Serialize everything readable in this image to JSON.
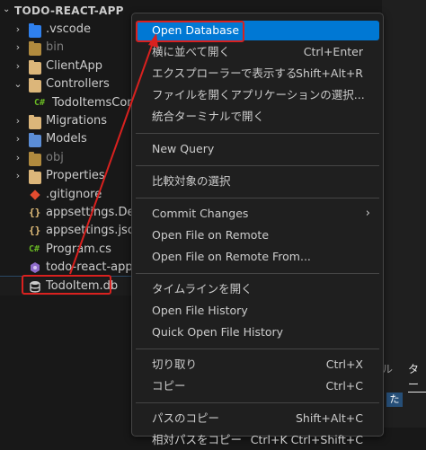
{
  "explorer": {
    "title": "TODO-REACT-APP",
    "items": [
      {
        "label": ".vscode",
        "type": "folder",
        "color": "#2f80ed",
        "chev": "›",
        "dim": false
      },
      {
        "label": "bin",
        "type": "folder",
        "color": "#b08a3e",
        "chev": "›",
        "dim": true
      },
      {
        "label": "ClientApp",
        "type": "folder",
        "color": "#dcb67a",
        "chev": "›",
        "dim": false
      },
      {
        "label": "Controllers",
        "type": "folder",
        "color": "#dcb67a",
        "chev": "⌄",
        "dim": false
      },
      {
        "label": "TodoItemsContro",
        "type": "csharp",
        "chev": "",
        "dim": false
      },
      {
        "label": "Migrations",
        "type": "folder",
        "color": "#dcb67a",
        "chev": "›",
        "dim": false
      },
      {
        "label": "Models",
        "type": "folder",
        "color": "#5b8dd6",
        "chev": "›",
        "dim": false
      },
      {
        "label": "obj",
        "type": "folder",
        "color": "#b08a3e",
        "chev": "›",
        "dim": true
      },
      {
        "label": "Properties",
        "type": "folder",
        "color": "#dcb67a",
        "chev": "›",
        "dim": false
      },
      {
        "label": ".gitignore",
        "type": "git",
        "chev": "",
        "dim": false
      },
      {
        "label": "appsettings.Develo",
        "type": "json",
        "chev": "",
        "dim": false
      },
      {
        "label": "appsettings.json",
        "type": "json",
        "chev": "",
        "dim": false
      },
      {
        "label": "Program.cs",
        "type": "csharp",
        "chev": "",
        "dim": false
      },
      {
        "label": "todo-react-app.cs",
        "type": "csproj",
        "chev": "",
        "dim": false
      },
      {
        "label": "TodoItem.db",
        "type": "db",
        "chev": "",
        "dim": false
      }
    ]
  },
  "menu": {
    "items": [
      {
        "label": "Open Database",
        "shortcut": "",
        "active": true
      },
      {
        "label": "横に並べて開く",
        "shortcut": "Ctrl+Enter"
      },
      {
        "label": "エクスプローラーで表示する",
        "shortcut": "Shift+Alt+R"
      },
      {
        "label": "ファイルを開くアプリケーションの選択...",
        "shortcut": ""
      },
      {
        "label": "統合ターミナルで開く",
        "shortcut": ""
      },
      {
        "sep": true
      },
      {
        "label": "New Query",
        "shortcut": ""
      },
      {
        "sep": true
      },
      {
        "label": "比較対象の選択",
        "shortcut": ""
      },
      {
        "sep": true
      },
      {
        "label": "Commit Changes",
        "shortcut": "",
        "submenu": true
      },
      {
        "label": "Open File on Remote",
        "shortcut": ""
      },
      {
        "label": "Open File on Remote From...",
        "shortcut": ""
      },
      {
        "sep": true
      },
      {
        "label": "タイムラインを開く",
        "shortcut": ""
      },
      {
        "label": "Open File History",
        "shortcut": ""
      },
      {
        "label": "Quick Open File History",
        "shortcut": ""
      },
      {
        "sep": true
      },
      {
        "label": "切り取り",
        "shortcut": "Ctrl+X"
      },
      {
        "label": "コピー",
        "shortcut": "Ctrl+C"
      },
      {
        "sep": true
      },
      {
        "label": "パスのコピー",
        "shortcut": "Shift+Alt+C"
      },
      {
        "label": "相対パスをコピー",
        "shortcut": "Ctrl+K Ctrl+Shift+C"
      }
    ]
  },
  "panel": {
    "tabs": [
      {
        "label": "ル",
        "active": false
      },
      {
        "label": "ター",
        "active": true
      }
    ],
    "chip": "た"
  },
  "colors": {
    "highlight_border": "#d9211f",
    "menu_active": "#0078d4"
  }
}
